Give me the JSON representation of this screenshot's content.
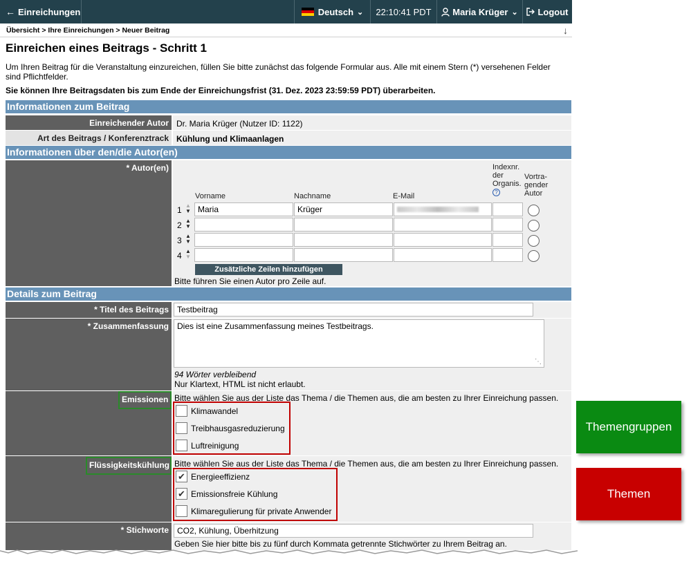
{
  "topbar": {
    "back_label": "Einreichungen",
    "language": "Deutsch",
    "time": "22:10:41 PDT",
    "user": "Maria Krüger",
    "logout": "Logout"
  },
  "breadcrumb": "Übersicht > Ihre Einreichungen > Neuer Beitrag",
  "page_title": "Einreichen eines Beitrags - Schritt 1",
  "intro": "Um Ihren Beitrag für die Veranstaltung einzureichen, füllen Sie bitte zunächst das folgende Formular aus. Alle mit einem Stern (*) versehenen Felder sind Pflichtfelder.",
  "deadline_note": "Sie können Ihre Beitragsdaten bis zum Ende der Einreichungsfrist (31. Dez. 2023 23:59:59 PDT) überarbeiten.",
  "sections": {
    "info": "Informationen zum Beitrag",
    "authors": "Informationen über den/die Autor(en)",
    "details": "Details zum Beitrag"
  },
  "info": {
    "submitter_label": "Einreichender Autor",
    "submitter_value": "Dr. Maria Krüger (Nutzer ID: 1122)",
    "track_label": "Art des Beitrags / Konferenztrack",
    "track_value": "Kühlung und Klimaanlagen"
  },
  "authors": {
    "label": "* Autor(en)",
    "col_first": "Vorname",
    "col_last": "Nachname",
    "col_email": "E-Mail",
    "col_index": "Indexnr. der Organis.",
    "col_index_help": "?",
    "col_presenting": "Vortra-gender Autor",
    "rows": [
      {
        "num": "1",
        "first": "Maria",
        "last": "Krüger"
      },
      {
        "num": "2",
        "first": "",
        "last": ""
      },
      {
        "num": "3",
        "first": "",
        "last": ""
      },
      {
        "num": "4",
        "first": "",
        "last": ""
      }
    ],
    "add_rows_button": "Zusätzliche Zeilen hinzufügen",
    "hint": "Bitte führen Sie einen Autor pro Zeile auf."
  },
  "details": {
    "title_label": "* Titel des Beitrags",
    "title_value": "Testbeitrag",
    "abstract_label": "* Zusammenfassung",
    "abstract_value": "Dies ist eine Zusammenfassung meines Testbeitrags.",
    "words_left": "94 Wörter verbleibend",
    "plain_text": "Nur Klartext, HTML ist nicht erlaubt.",
    "topic_hint": "Bitte wählen Sie aus der Liste das Thema / die Themen aus, die am besten zu Ihrer Einreichung passen.",
    "group1_label": "Emissionen",
    "group1_topics": [
      {
        "label": "Klimawandel",
        "checked": false
      },
      {
        "label": "Treibhausgasreduzierung",
        "checked": false
      },
      {
        "label": "Luftreinigung",
        "checked": false
      }
    ],
    "group2_label": "Flüssigkeitskühlung",
    "group2_topics": [
      {
        "label": "Energieeffizienz",
        "checked": true
      },
      {
        "label": "Emissionsfreie Kühlung",
        "checked": true
      },
      {
        "label": "Klimaregulierung für private Anwender",
        "checked": false
      }
    ],
    "keywords_label": "* Stichworte",
    "keywords_value": "CO2, Kühlung, Überhitzung",
    "keywords_hint": "Geben Sie hier bitte bis zu fünf durch Kommata getrennte Stichwörter zu Ihrem Beitrag an."
  },
  "legend": {
    "groups": "Themengruppen",
    "topics": "Themen"
  },
  "colors": {
    "topbar": "#23414c",
    "section": "#6893b8",
    "label_dark": "#5f5f5f",
    "annot_red": "#c00000",
    "annot_green": "#2a8a2a",
    "legend_green": "#0a8a12",
    "legend_red": "#c80000"
  }
}
